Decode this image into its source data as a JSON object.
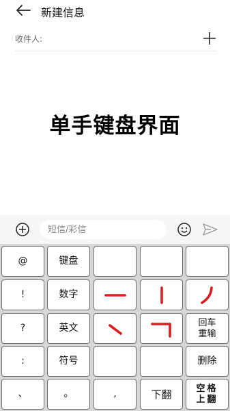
{
  "header": {
    "title": "新建信息",
    "back_icon": "arrow-left-icon"
  },
  "recipient": {
    "label": "收件人:",
    "add_icon": "plus-icon"
  },
  "overlay_text": "单手键盘界面",
  "compose": {
    "placeholder": "短信/彩信",
    "attach_icon": "circle-plus-icon",
    "emoji_icon": "smiley-icon",
    "send_icon": "send-icon"
  },
  "keyboard": {
    "stroke_color": "#d81e1e",
    "rows": [
      [
        {
          "label": "@"
        },
        {
          "label": "键盘"
        },
        {
          "label": ""
        },
        {
          "label": ""
        },
        {
          "label": ""
        }
      ],
      [
        {
          "label": "!"
        },
        {
          "label": "数字"
        },
        {
          "stroke": "heng"
        },
        {
          "stroke": "shu"
        },
        {
          "stroke": "pie"
        }
      ],
      [
        {
          "label": "?"
        },
        {
          "label": "英文"
        },
        {
          "stroke": "dian"
        },
        {
          "stroke": "zhe"
        },
        {
          "line1": "回车",
          "line2": "重输"
        }
      ],
      [
        {
          "label": ":"
        },
        {
          "label": "符号"
        },
        {
          "label": ""
        },
        {
          "label": ""
        },
        {
          "label": "删除"
        }
      ],
      [
        {
          "label": "、"
        },
        {
          "label": "。"
        },
        {
          "label": ","
        },
        {
          "label": "下翻"
        },
        {
          "line1": "空格",
          "line2": "上翻"
        }
      ]
    ]
  }
}
